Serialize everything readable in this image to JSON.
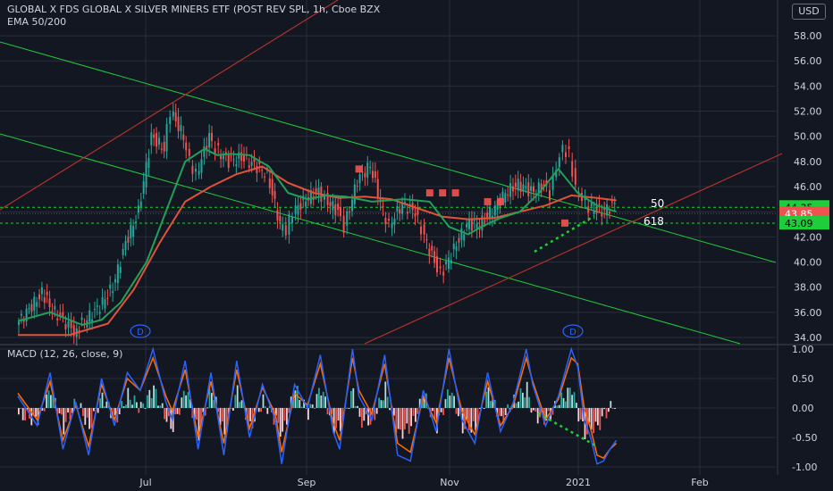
{
  "header": {
    "title": "GLOBAL X FDS GLOBAL X SILVER MINERS ETF (POST REV SPL, 1h, Cboe BZX",
    "indicator": "EMA 50/200",
    "currency": "USD"
  },
  "colors": {
    "background": "#131722",
    "grid": "#2a2e39",
    "up": "#26a69a",
    "down": "#ef5350",
    "ema_fast": "#22a05a",
    "ema_slow": "#e0533a",
    "channel_green": "#1fcc3a",
    "channel_red": "#b2322a",
    "macd_line": "#2962ff",
    "signal_line": "#ff6d00"
  },
  "chart_data": [
    {
      "type": "line",
      "title": "GLOBAL X FDS GLOBAL X SILVER MINERS ETF (POST REV SPL, 1h, Cboe BZX",
      "ylim": [
        34,
        59
      ],
      "y_ticks": [
        "58.00",
        "56.00",
        "54.00",
        "52.00",
        "50.00",
        "48.00",
        "46.00",
        "44.00",
        "42.00",
        "40.00",
        "38.00",
        "36.00",
        "34.00"
      ],
      "x_ticks": [
        "Jul",
        "Sep",
        "Nov",
        "2021",
        "Feb"
      ],
      "grid": true,
      "series": [
        {
          "name": "EMA 50",
          "x": [
            0,
            5,
            10,
            13,
            16,
            20,
            23,
            26,
            29,
            31,
            33,
            36,
            39,
            42,
            45,
            48,
            51,
            55,
            60,
            64,
            67,
            70,
            72,
            75,
            78,
            81,
            84,
            87,
            90,
            93
          ],
          "y": [
            35.3,
            36.0,
            35.0,
            35.4,
            36.8,
            40.0,
            44.0,
            48.0,
            49.0,
            48.5,
            48.6,
            48.5,
            47.6,
            45.5,
            45.0,
            45.3,
            45.2,
            44.8,
            45.0,
            44.8,
            42.8,
            42.2,
            42.8,
            43.5,
            44.0,
            45.5,
            47.4,
            45.5,
            44.5,
            44.0
          ]
        },
        {
          "name": "EMA 200",
          "x": [
            0,
            8,
            14,
            18,
            22,
            26,
            30,
            34,
            38,
            42,
            46,
            50,
            54,
            58,
            62,
            66,
            70,
            74,
            78,
            82,
            86,
            90,
            93
          ],
          "y": [
            34.2,
            34.2,
            35.1,
            37.8,
            41.5,
            44.8,
            46.0,
            47.0,
            47.6,
            46.3,
            45.5,
            45.1,
            45.2,
            45.0,
            44.3,
            43.6,
            43.4,
            43.5,
            44.0,
            44.5,
            45.3,
            45.1,
            44.9
          ]
        },
        {
          "name": "Price",
          "x": [
            0,
            4,
            6,
            9,
            11,
            13,
            15,
            17,
            19,
            21,
            23,
            24,
            26,
            27,
            28,
            30,
            31,
            33,
            35,
            37,
            39,
            41,
            42,
            43,
            45,
            47,
            48,
            50,
            51,
            53,
            55,
            57,
            58,
            60,
            62,
            63,
            65,
            66,
            68,
            70,
            72,
            74,
            76,
            78,
            80,
            82,
            83,
            84,
            85,
            86,
            87,
            88,
            89,
            91,
            93
          ],
          "y": [
            35,
            37.5,
            36,
            34.5,
            35.5,
            36.5,
            38,
            41.5,
            44,
            50,
            49,
            52,
            50,
            48,
            47,
            50,
            49,
            48,
            48.3,
            47.7,
            47,
            43,
            42.6,
            44,
            45,
            45.6,
            45,
            44,
            42.8,
            46.5,
            47.7,
            44,
            43,
            44.6,
            44,
            42.5,
            40,
            39,
            41,
            43,
            43,
            44.1,
            45.5,
            46.2,
            45.6,
            46,
            45.4,
            47.5,
            49,
            48.5,
            46,
            45.2,
            44.4,
            44,
            44.6
          ]
        }
      ],
      "annotations": [
        "D",
        "D",
        "50",
        "618"
      ],
      "price_labels": [
        {
          "text": "44.35",
          "value": 44.35
        },
        {
          "text": "43.85",
          "value": 43.85
        },
        {
          "text": "43.09",
          "value": 43.09
        }
      ],
      "reference_lines": [
        44.35,
        43.09
      ]
    },
    {
      "type": "line",
      "title": "MACD (12, 26, close, 9)",
      "ylim": [
        -1.05,
        1.05
      ],
      "y_ticks": [
        "1.00",
        "0.50",
        "0.00",
        "-0.50",
        "-1.00"
      ],
      "series": [
        {
          "name": "MACD",
          "x": [
            0,
            3,
            5,
            7,
            9,
            11,
            13,
            15,
            17,
            19,
            21,
            23,
            24,
            26,
            28,
            30,
            32,
            34,
            36,
            38,
            40,
            41,
            43,
            45,
            47,
            49,
            50,
            52,
            53,
            55,
            57,
            59,
            61,
            63,
            65,
            67,
            69,
            71,
            73,
            75,
            77,
            79,
            80,
            82,
            84,
            86,
            87,
            88,
            89,
            90,
            91,
            92,
            93
          ],
          "y": [
            0.2,
            -0.3,
            0.6,
            -0.7,
            0.1,
            -0.8,
            0.5,
            -0.3,
            0.6,
            0.3,
            1.0,
            0.1,
            -0.2,
            0.8,
            -0.7,
            0.6,
            -0.8,
            0.8,
            -0.5,
            0.4,
            -0.2,
            -0.95,
            0.4,
            0.0,
            0.9,
            -0.4,
            -0.7,
            1.0,
            0.2,
            -0.2,
            0.9,
            -0.8,
            -0.9,
            0.3,
            -0.4,
            1.0,
            -0.2,
            -0.6,
            0.6,
            -0.4,
            0.1,
            1.0,
            0.4,
            -0.3,
            0.2,
            1.0,
            0.7,
            -0.2,
            -0.5,
            -0.95,
            -0.9,
            -0.7,
            -0.55
          ]
        },
        {
          "name": "Signal",
          "x": [
            0,
            3,
            5,
            7,
            9,
            11,
            13,
            15,
            17,
            19,
            21,
            23,
            24,
            26,
            28,
            30,
            32,
            34,
            36,
            38,
            40,
            41,
            43,
            45,
            47,
            49,
            50,
            52,
            53,
            55,
            57,
            59,
            61,
            63,
            65,
            67,
            69,
            71,
            73,
            75,
            77,
            79,
            80,
            82,
            84,
            86,
            87,
            88,
            89,
            90,
            91,
            92,
            93
          ],
          "y": [
            0.25,
            -0.2,
            0.45,
            -0.55,
            0.05,
            -0.65,
            0.4,
            -0.2,
            0.5,
            0.3,
            0.85,
            0.2,
            -0.05,
            0.65,
            -0.5,
            0.45,
            -0.6,
            0.65,
            -0.35,
            0.35,
            -0.1,
            -0.75,
            0.25,
            0.05,
            0.75,
            -0.25,
            -0.55,
            0.85,
            0.3,
            -0.1,
            0.75,
            -0.6,
            -0.75,
            0.2,
            -0.25,
            0.85,
            -0.05,
            -0.45,
            0.45,
            -0.3,
            0.05,
            0.85,
            0.45,
            -0.2,
            0.15,
            0.85,
            0.75,
            0.0,
            -0.35,
            -0.8,
            -0.85,
            -0.7,
            -0.6
          ]
        }
      ]
    }
  ]
}
